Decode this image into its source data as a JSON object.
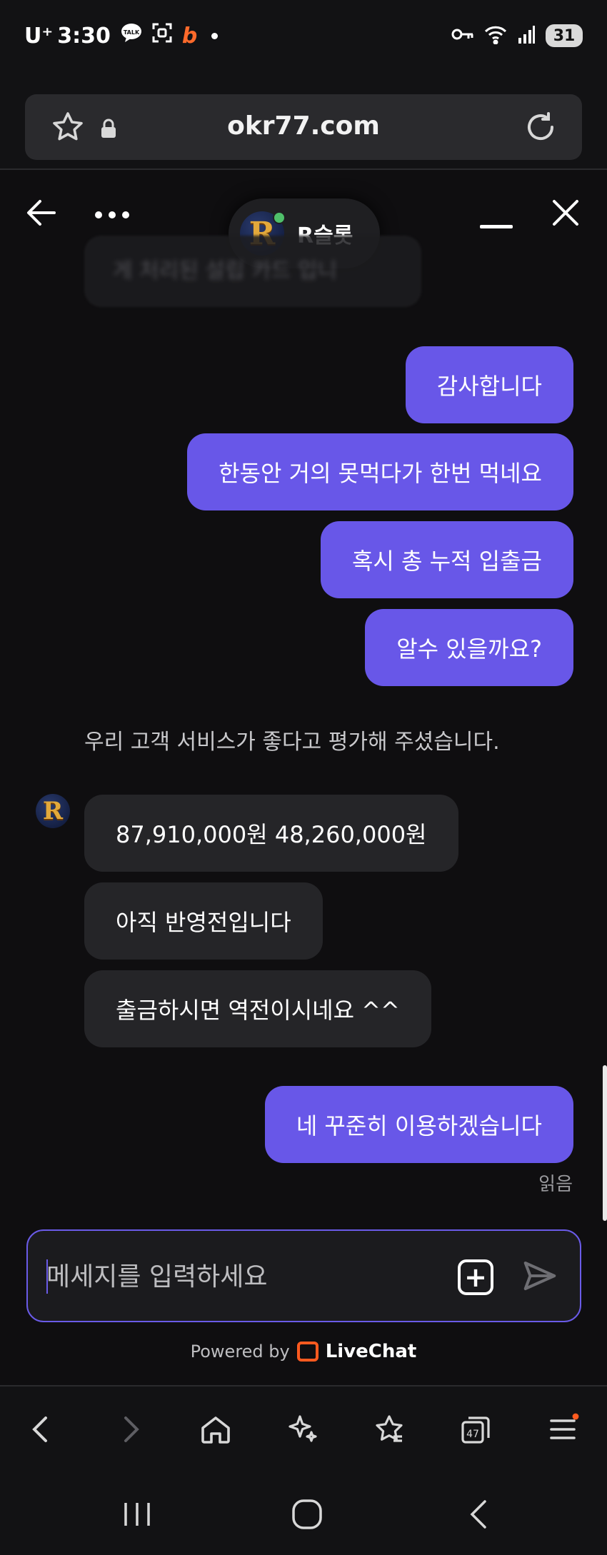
{
  "status_bar": {
    "carrier": "U⁺",
    "time": "3:30",
    "battery": "31",
    "icons": [
      "talk-icon",
      "screenshot-icon",
      "b-app-icon",
      "dot-icon",
      "key-icon",
      "wifi-icon",
      "signal-icon",
      "battery-icon"
    ]
  },
  "browser": {
    "url": "okr77.com",
    "toolbar_icons": [
      "back-icon",
      "forward-icon",
      "home-icon",
      "ai-sparkle-icon",
      "favorites-icon",
      "tabs-icon",
      "menu-icon"
    ],
    "tabs_count": "47",
    "accent_notification": "#ff5a1f"
  },
  "chat": {
    "agent_name": "R슬롯",
    "agent_logo_letter": "R",
    "faded_preview": "게 처리된 설립 카드 입니",
    "messages_out_1": [
      "감사합니다",
      "한동안 거의 못먹다가 한번 먹네요",
      "혹시 총 누적 입출금",
      "알수 있을까요?"
    ],
    "rating_note": "우리 고객 서비스가 좋다고 평가해 주셨습니다.",
    "messages_in": [
      "87,910,000원 48,260,000원",
      "아직 반영전입니다",
      "출금하시면 역전이시네요 ^^"
    ],
    "messages_out_2": [
      "네 꾸준히 이용하겠습니다"
    ],
    "read_label": "읽음",
    "colors": {
      "outgoing": "#6857e8",
      "incoming": "#252528",
      "background": "#0f0e10"
    }
  },
  "composer": {
    "placeholder": "메세지를 입력하세요",
    "value": ""
  },
  "footer": {
    "powered_by": "Powered by",
    "brand": "LiveChat"
  }
}
